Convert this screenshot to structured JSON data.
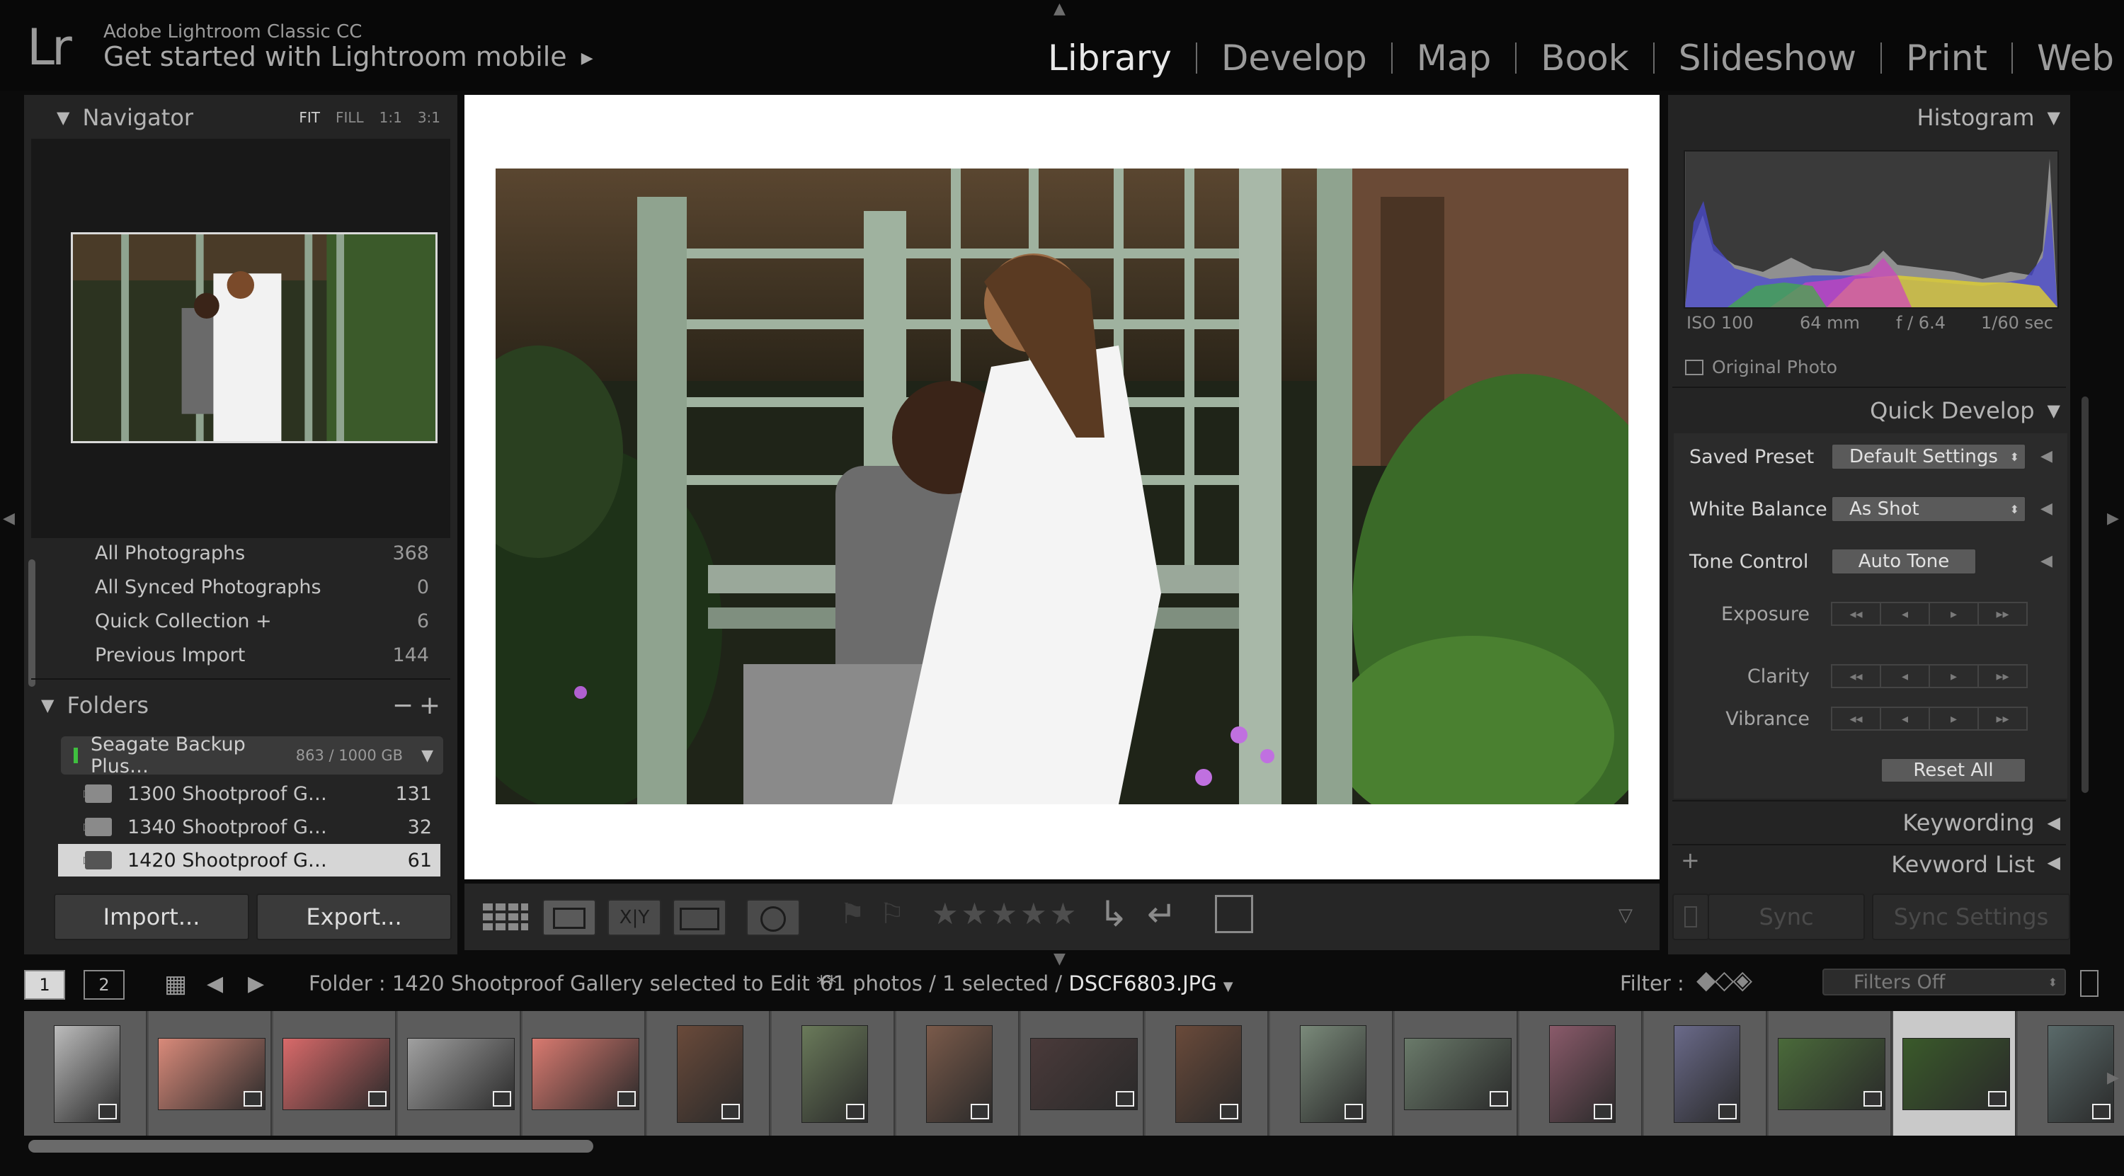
{
  "app": {
    "logo": "Lr",
    "name": "Adobe Lightroom Classic CC",
    "subtitle": "Get started with Lightroom mobile"
  },
  "modules": [
    "Library",
    "Develop",
    "Map",
    "Book",
    "Slideshow",
    "Print",
    "Web"
  ],
  "navigator": {
    "title": "Navigator",
    "options": [
      "FIT",
      "FILL",
      "1:1",
      "3:1"
    ]
  },
  "catalog": {
    "rows": [
      {
        "label": "All Photographs",
        "count": "368"
      },
      {
        "label": "All Synced Photographs",
        "count": "0"
      },
      {
        "label": "Quick Collection +",
        "count": "6"
      },
      {
        "label": "Previous Import",
        "count": "144"
      }
    ]
  },
  "folders": {
    "title": "Folders",
    "volume": {
      "name": "Seagate Backup Plus…",
      "size": "863 / 1000 GB"
    },
    "items": [
      {
        "name": "1300 Shootproof G…",
        "count": "131"
      },
      {
        "name": "1340 Shootproof G…",
        "count": "32"
      },
      {
        "name": "1420 Shootproof G…",
        "count": "61"
      }
    ]
  },
  "buttons": {
    "import": "Import...",
    "export": "Export..."
  },
  "histogram": {
    "title": "Histogram",
    "iso": "ISO 100",
    "focal": "64 mm",
    "aperture": "f / 6.4",
    "shutter": "1/60 sec",
    "original_photo": "Original Photo"
  },
  "quick_develop": {
    "title": "Quick Develop",
    "saved_preset_label": "Saved Preset",
    "saved_preset_value": "Default Settings",
    "white_balance_label": "White Balance",
    "white_balance_value": "As Shot",
    "tone_control_label": "Tone Control",
    "auto_tone": "Auto Tone",
    "exposure": "Exposure",
    "clarity": "Clarity",
    "vibrance": "Vibrance",
    "reset_all": "Reset All"
  },
  "right_sections": {
    "keywording": "Keywording",
    "keyword_list": "Keyword List"
  },
  "sync": {
    "sync": "Sync",
    "sync_settings": "Sync Settings"
  },
  "filmbar": {
    "page1": "1",
    "page2": "2",
    "folder_info": "Folder : 1420 Shootproof Gallery selected to Edit **",
    "photos_info": "61 photos / 1 selected /",
    "filename": "DSCF6803.JPG",
    "filter_label": "Filter :",
    "filter_value": "Filters Off"
  },
  "colors": {
    "background": "#0b0b0b",
    "panel": "#242424",
    "active_module": "#e8e8e8"
  }
}
